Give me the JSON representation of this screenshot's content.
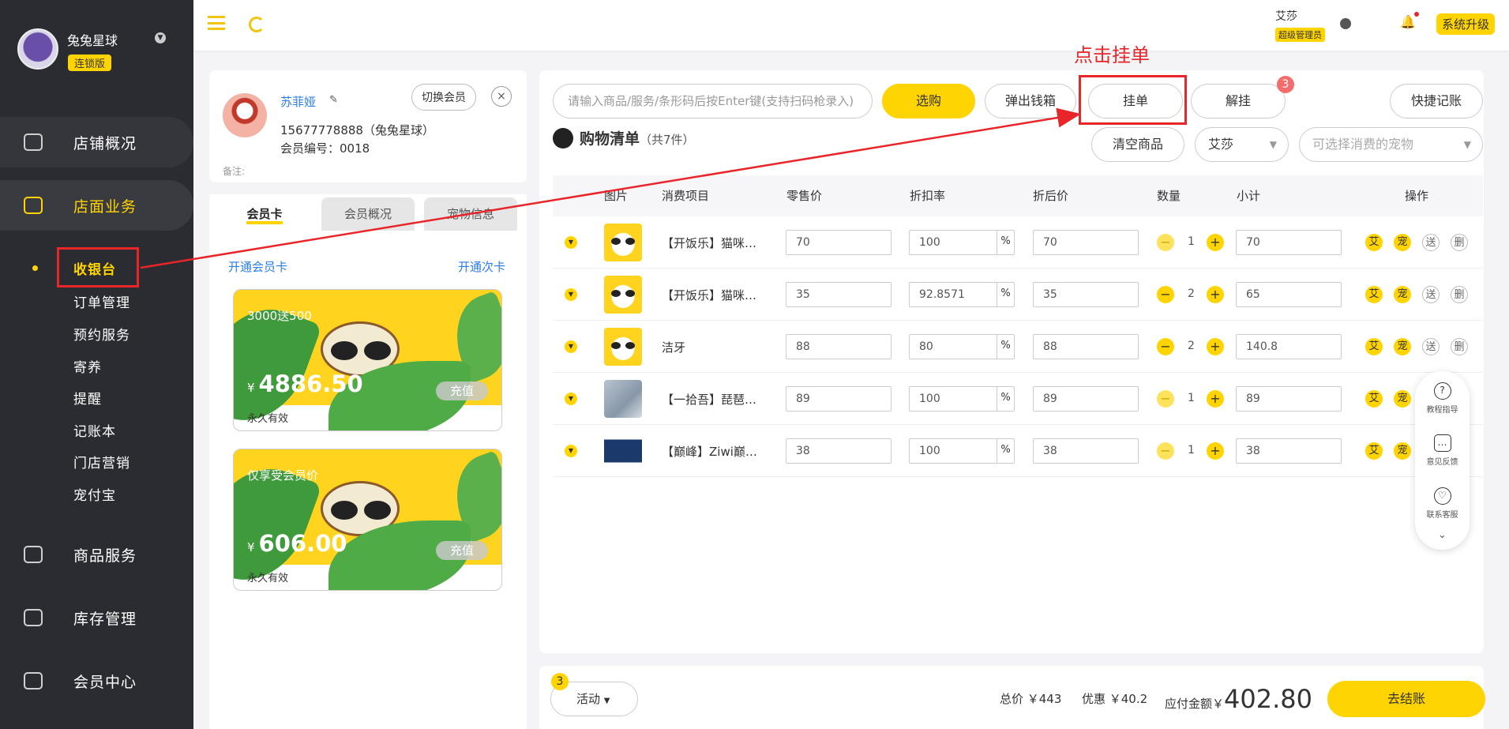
{
  "sidebar": {
    "brand_name": "兔兔星球",
    "brand_badge": "连锁版",
    "nav": [
      "店铺概况",
      "店面业务",
      "商品服务",
      "库存管理",
      "会员中心"
    ],
    "sub": [
      "收银台",
      "订单管理",
      "预约服务",
      "寄养",
      "提醒",
      "记账本",
      "门店营销",
      "宠付宝"
    ]
  },
  "topbar": {
    "admin_name": "艾莎",
    "admin_role": "超级管理员",
    "upgrade": "系统升级"
  },
  "member": {
    "name": "苏菲娅",
    "phone": "15677778888（兔兔星球）",
    "number": "会员编号：0018",
    "note": "备注:",
    "switch": "切换会员",
    "close": "×",
    "tabs": [
      "会员卡",
      "会员概况",
      "宠物信息"
    ],
    "open_card": "开通会员卡",
    "open_times": "开通次卡",
    "cards": [
      {
        "title": "3000送500",
        "currency": "¥",
        "amount": "4886.50",
        "recharge": "充值",
        "validity": "永久有效"
      },
      {
        "title": "仅享受会员价",
        "currency": "¥",
        "amount": "606.00",
        "recharge": "充值",
        "validity": "永久有效"
      }
    ]
  },
  "toolbar": {
    "search_placeholder": "请输入商品/服务/条形码后按Enter键(支持扫码枪录入)",
    "select_btn": "选购",
    "cash_drawer": "弹出钱箱",
    "hang_order": "挂单",
    "unhang": "解挂",
    "unhang_badge": "3",
    "quick_note": "快捷记账",
    "annotation": "点击挂单"
  },
  "cart": {
    "title": "购物清单",
    "count": "（共7件）",
    "clear": "清空商品",
    "staff": "艾莎",
    "pet_placeholder": "可选择消费的宠物",
    "headers": [
      "图片",
      "消费项目",
      "零售价",
      "折扣率",
      "折后价",
      "数量",
      "小计",
      "操作"
    ],
    "rows": [
      {
        "name": "【开饭乐】猫咪…",
        "price": "70",
        "rate": "100",
        "after": "70",
        "qty": "1",
        "subtotal": "70"
      },
      {
        "name": "【开饭乐】猫咪…",
        "price": "35",
        "rate": "92.8571",
        "after": "35",
        "qty": "2",
        "subtotal": "65"
      },
      {
        "name": "洁牙",
        "price": "88",
        "rate": "80",
        "after": "88",
        "qty": "2",
        "subtotal": "140.8"
      },
      {
        "name": "【一拾吾】琵琶…",
        "price": "89",
        "rate": "100",
        "after": "89",
        "qty": "1",
        "subtotal": "89"
      },
      {
        "name": "【巅峰】Ziwi巅…",
        "price": "38",
        "rate": "100",
        "after": "38",
        "qty": "1",
        "subtotal": "38"
      }
    ],
    "pct": "%",
    "minus": "−",
    "plus": "+",
    "act_ai": "艾",
    "act_pet": "宠",
    "act_send": "送",
    "act_del": "删"
  },
  "help": [
    "教程指导",
    "意见反馈",
    "联系客服"
  ],
  "footer": {
    "activity": "活动",
    "activity_badge": "3",
    "total": "总价 ￥443",
    "discount": "优惠 ￥40.2",
    "payable_label": "应付金额￥",
    "payable": "402.80",
    "checkout": "去结账"
  },
  "colors": {
    "accent": "#ffd400",
    "sidebar": "#2b2c31",
    "annotation": "#e8262a",
    "link": "#2b7de9"
  }
}
